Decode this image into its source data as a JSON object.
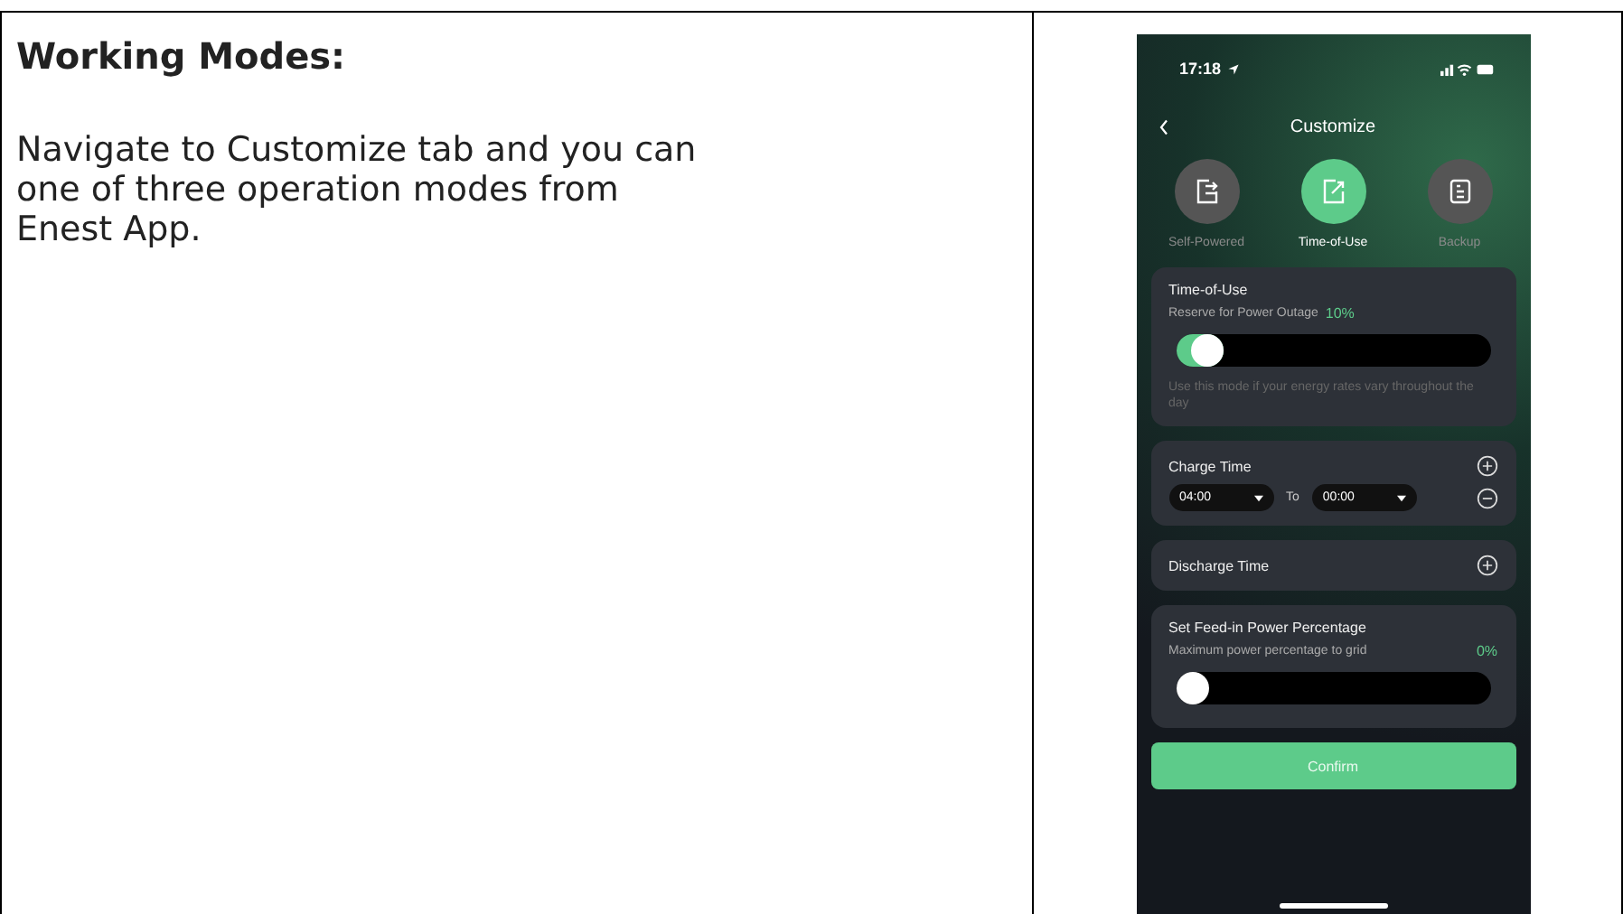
{
  "document": {
    "heading": "Working Modes:",
    "body": "Navigate to Customize tab and you can one of three operation modes from Enest App."
  },
  "phone": {
    "status_time": "17:18",
    "title": "Customize",
    "modes": [
      {
        "label": "Self-Powered",
        "selected": false,
        "kind": "self"
      },
      {
        "label": "Time-of-Use",
        "selected": true,
        "kind": "tou"
      },
      {
        "label": "Backup",
        "selected": false,
        "kind": "backup"
      }
    ],
    "mode_card": {
      "title": "Time-of-Use",
      "reserve_label": "Reserve for Power Outage",
      "reserve_value": "10%",
      "level": 0.1,
      "hint": "Use this mode if your energy rates vary throughout the day"
    },
    "charge_time": {
      "title": "Charge Time",
      "start": "04:00",
      "separator": "To",
      "end": "00:00"
    },
    "discharge_time": {
      "title": "Discharge Time"
    },
    "feed_in": {
      "title": "Set Feed-in Power Percentage",
      "label": "Maximum power percentage to grid",
      "value": "0%",
      "level": 0
    },
    "confirm": "Confirm"
  }
}
